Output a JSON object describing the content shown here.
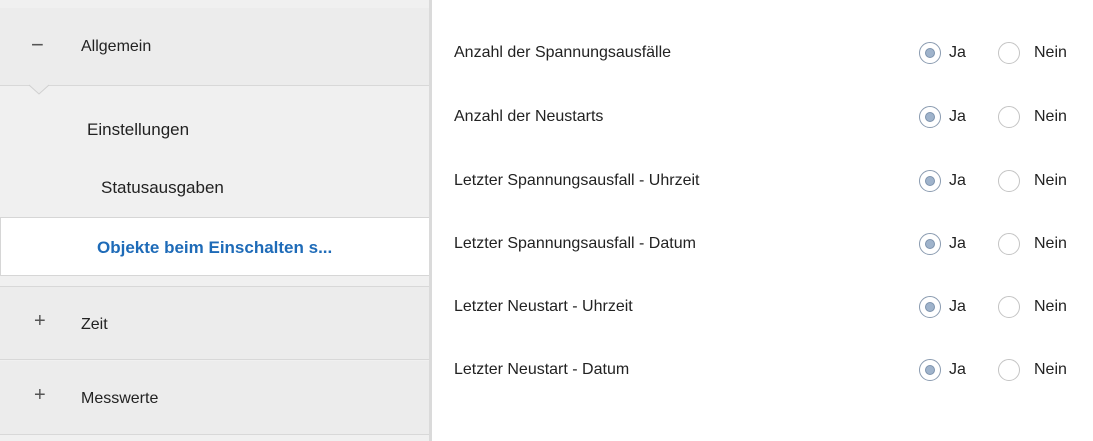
{
  "sidebar": {
    "groups": [
      {
        "symbol": "−",
        "label": "Allgemein",
        "expanded": true
      },
      {
        "symbol": "+",
        "label": "Zeit",
        "expanded": false
      },
      {
        "symbol": "+",
        "label": "Messwerte",
        "expanded": false
      }
    ],
    "children": [
      {
        "label": "Einstellungen",
        "active": false
      },
      {
        "label": "Statusausgaben",
        "active": false
      },
      {
        "label": "Objekte beim Einschalten s...",
        "active": true
      }
    ]
  },
  "options": {
    "yes": "Ja",
    "no": "Nein"
  },
  "params": [
    {
      "label": "Anzahl der Spannungsausfälle",
      "selected": "Ja"
    },
    {
      "label": "Anzahl der Neustarts",
      "selected": "Ja"
    },
    {
      "label": "Letzter Spannungsausfall - Uhrzeit",
      "selected": "Ja"
    },
    {
      "label": "Letzter Spannungsausfall - Datum",
      "selected": "Ja"
    },
    {
      "label": "Letzter Neustart - Uhrzeit",
      "selected": "Ja"
    },
    {
      "label": "Letzter Neustart - Datum",
      "selected": "Ja"
    }
  ],
  "colors": {
    "sidebar_bg": "#f0f0f0",
    "active_text": "#1e6bb8",
    "radio_checked": "#9fb3cb"
  }
}
